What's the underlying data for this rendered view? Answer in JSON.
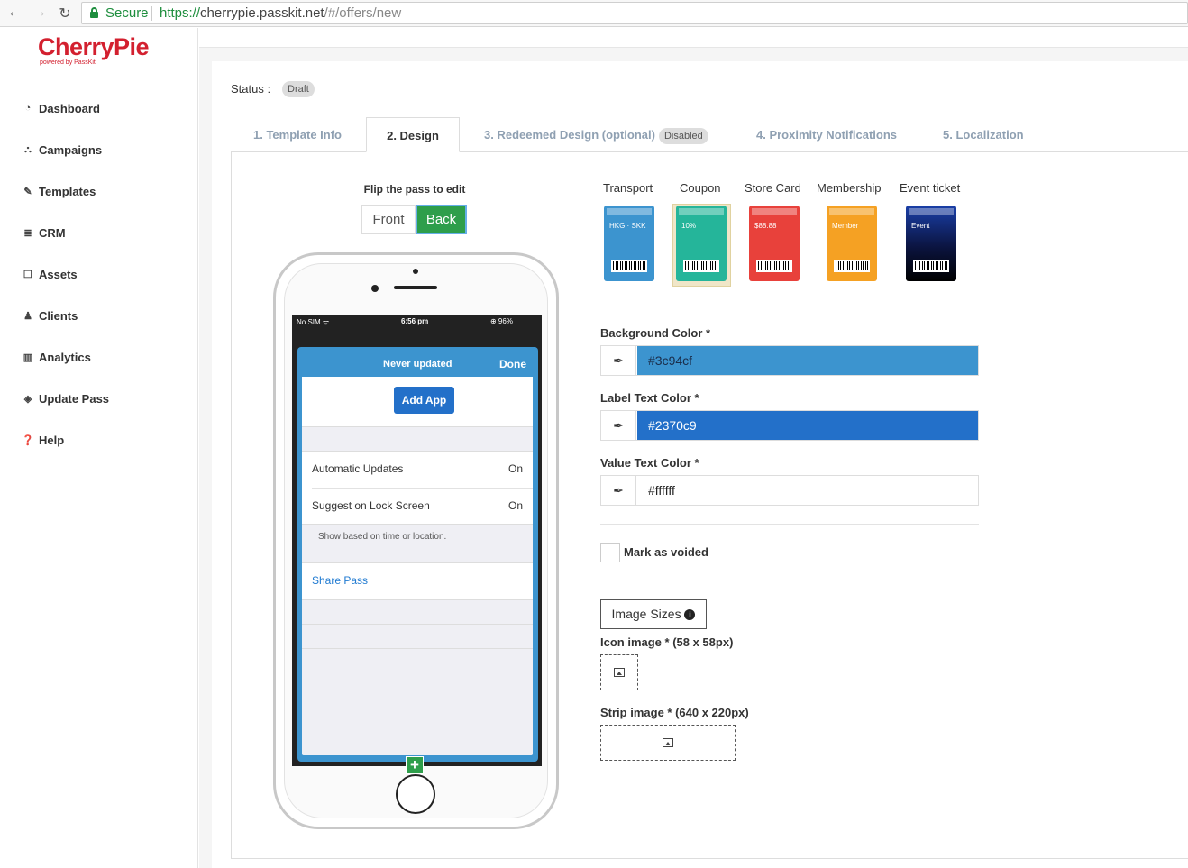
{
  "browser": {
    "secure_label": "Secure",
    "url_proto": "https://",
    "url_host": "cherrypie.passkit.net",
    "url_path": "/#/offers/new"
  },
  "logo": {
    "name": "CherryPie",
    "tagline": "powered by PassKit"
  },
  "sidebar": {
    "items": [
      {
        "label": "Dashboard",
        "icon": "dashboard-icon"
      },
      {
        "label": "Campaigns",
        "icon": "sitemap-icon"
      },
      {
        "label": "Templates",
        "icon": "pencil-icon"
      },
      {
        "label": "CRM",
        "icon": "database-icon"
      },
      {
        "label": "Assets",
        "icon": "copy-icon"
      },
      {
        "label": "Clients",
        "icon": "user-icon"
      },
      {
        "label": "Analytics",
        "icon": "bar-chart-icon"
      },
      {
        "label": "Update Pass",
        "icon": "tag-icon"
      },
      {
        "label": "Help",
        "icon": "question-icon"
      }
    ]
  },
  "status": {
    "label": "Status :",
    "badge": "Draft"
  },
  "tabs": [
    {
      "label": "1. Template Info"
    },
    {
      "label": "2. Design"
    },
    {
      "label": "3. Redeemed Design (optional)",
      "badge": "Disabled"
    },
    {
      "label": "4. Proximity Notifications"
    },
    {
      "label": "5. Localization"
    }
  ],
  "flip": {
    "title": "Flip the pass to edit",
    "front": "Front",
    "back": "Back"
  },
  "phone": {
    "status_left": "No SIM ᯤ",
    "status_time": "6:56 pm",
    "status_right": "⊕ 96%",
    "pass_header": "Never updated",
    "done": "Done",
    "add_app": "Add App",
    "rows": [
      {
        "label": "Automatic Updates",
        "value": "On"
      },
      {
        "label": "Suggest on Lock Screen",
        "value": "On"
      }
    ],
    "hint": "Show based on time or location.",
    "share": "Share Pass"
  },
  "pass_types": [
    {
      "label": "Transport",
      "color": "#3c94cf"
    },
    {
      "label": "Coupon",
      "color": "#25b59a"
    },
    {
      "label": "Store Card",
      "color": "#e8413b"
    },
    {
      "label": "Membership",
      "color": "#f5a123"
    },
    {
      "label": "Event ticket",
      "color": "#1a2a6c"
    }
  ],
  "colors": {
    "background": {
      "label": "Background Color *",
      "value": "#3c94cf"
    },
    "label_text": {
      "label": "Label Text Color *",
      "value": "#2370c9"
    },
    "value_text": {
      "label": "Value Text Color *",
      "value": "#ffffff"
    }
  },
  "voided": {
    "label": "Mark as voided"
  },
  "image_sizes": {
    "label": "Image Sizes"
  },
  "icon_image": {
    "label": "Icon image * (58 x 58px)"
  },
  "strip_image": {
    "label": "Strip image * (640 x 220px)"
  }
}
